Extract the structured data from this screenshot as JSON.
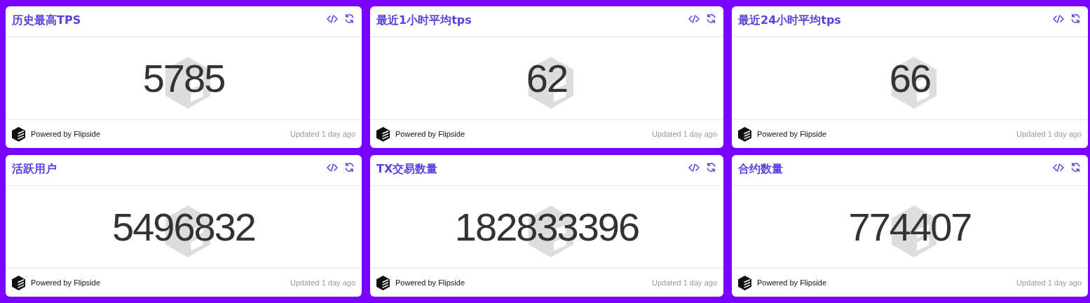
{
  "cards": [
    {
      "title": "历史最高TPS",
      "value": "5785",
      "powered_by": "Powered by Flipside",
      "updated": "Updated 1 day ago"
    },
    {
      "title": "最近1小时平均tps",
      "value": "62",
      "powered_by": "Powered by Flipside",
      "updated": "Updated 1 day ago"
    },
    {
      "title": "最近24小时平均tps",
      "value": "66",
      "powered_by": "Powered by Flipside",
      "updated": "Updated 1 day ago"
    },
    {
      "title": "活跃用户",
      "value": "5496832",
      "powered_by": "Powered by Flipside",
      "updated": "Updated 1 day ago"
    },
    {
      "title": "TX交易数量",
      "value": "182833396",
      "powered_by": "Powered by Flipside",
      "updated": "Updated 1 day ago"
    },
    {
      "title": "合约数量",
      "value": "774407",
      "powered_by": "Powered by Flipside",
      "updated": "Updated 1 day ago"
    }
  ]
}
